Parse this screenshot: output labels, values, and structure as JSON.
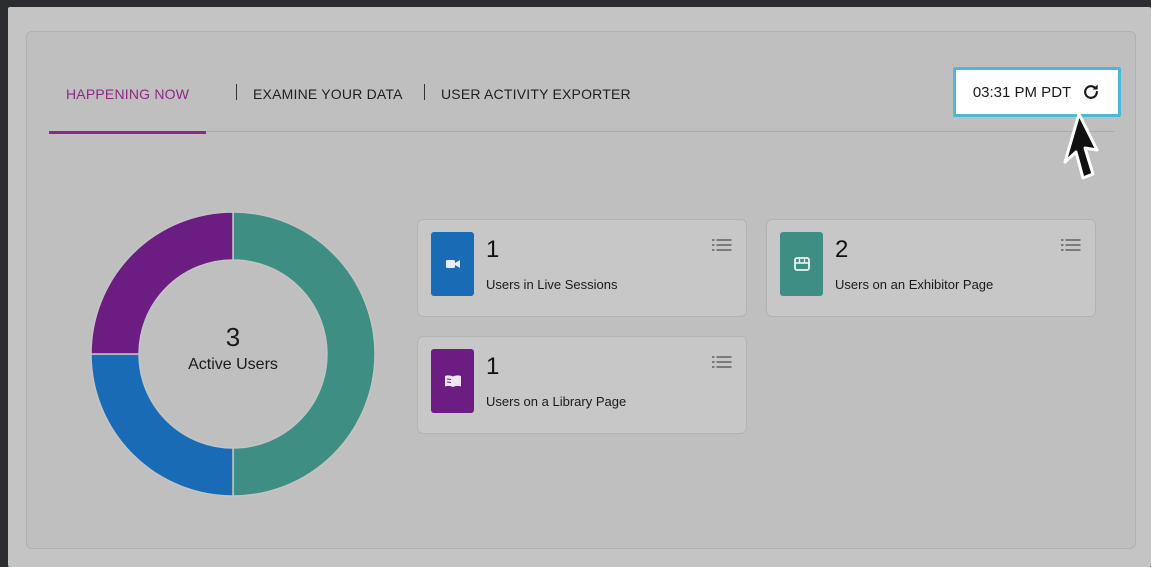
{
  "tabs": [
    {
      "label": "HAPPENING NOW",
      "active": true
    },
    {
      "label": "EXAMINE YOUR DATA",
      "active": false
    },
    {
      "label": "USER ACTIVITY EXPORTER",
      "active": false
    }
  ],
  "clock": {
    "time": "03:31 PM PDT",
    "refresh_icon": "refresh-icon"
  },
  "summary": {
    "value": "3",
    "label": "Active Users"
  },
  "chart_data": {
    "type": "pie",
    "categories": [
      "Users in Live Sessions",
      "Users on an Exhibitor Page",
      "Users on a Library Page"
    ],
    "values": [
      1,
      2,
      1
    ],
    "colors": [
      "#1a6bb5",
      "#3e8e84",
      "#6b1d82"
    ]
  },
  "cards": [
    {
      "value": "1",
      "label": "Users in Live Sessions",
      "icon": "video-camera-icon",
      "color": "#1a6bb5"
    },
    {
      "value": "2",
      "label": "Users on an Exhibitor Page",
      "icon": "storefront-icon",
      "color": "#3e8e84"
    },
    {
      "value": "1",
      "label": "Users on a Library Page",
      "icon": "book-icon",
      "color": "#6b1d82"
    }
  ],
  "colors": {
    "accent": "#8c2a83",
    "highlight": "#4ab9d6"
  }
}
